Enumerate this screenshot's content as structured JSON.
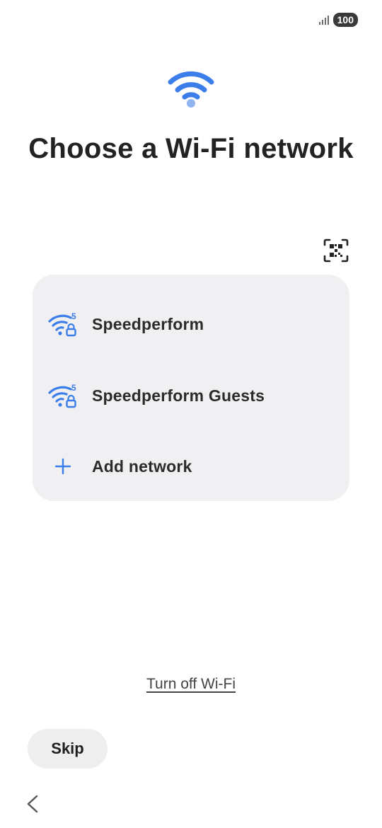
{
  "status_bar": {
    "battery": "100",
    "signal_icon": "cellular-signal-icon"
  },
  "header": {
    "icon": "wifi-icon",
    "title": "Choose a Wi-Fi network"
  },
  "qr_scan": {
    "icon": "qr-code-scan-icon"
  },
  "networks": [
    {
      "name": "Speedperform",
      "icon": "wifi-5ghz-locked-icon",
      "band": "5"
    },
    {
      "name": "Speedperform Guests",
      "icon": "wifi-5ghz-locked-icon",
      "band": "5"
    }
  ],
  "add_network": {
    "label": "Add network",
    "icon": "plus-icon"
  },
  "turn_off_wifi": "Turn off Wi-Fi",
  "skip_label": "Skip",
  "nav": {
    "back_icon": "chevron-left-icon"
  },
  "colors": {
    "accent": "#3b7de9",
    "accent_light": "#8fb4f0",
    "card_bg": "#f0f0f2"
  }
}
